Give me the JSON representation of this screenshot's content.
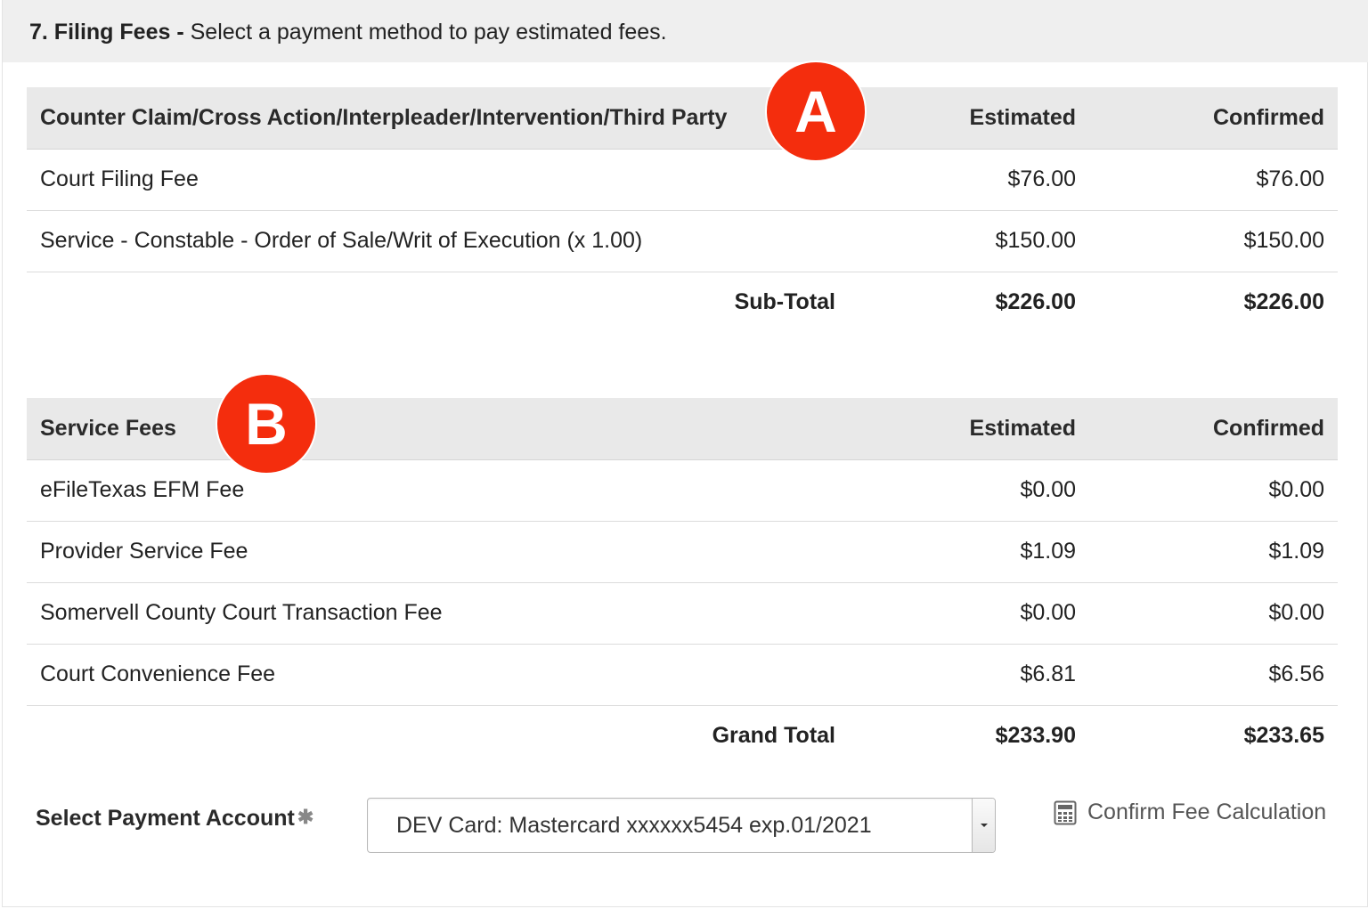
{
  "header": {
    "section_number": "7. Filing Fees -",
    "instruction": "Select a payment method to pay estimated fees."
  },
  "filing_table": {
    "title": "Counter Claim/Cross Action/Interpleader/Intervention/Third Party",
    "col_estimated": "Estimated",
    "col_confirmed": "Confirmed",
    "rows": [
      {
        "label": "Court Filing Fee",
        "estimated": "$76.00",
        "confirmed": "$76.00"
      },
      {
        "label": "Service - Constable - Order of Sale/Writ of Execution (x 1.00)",
        "estimated": "$150.00",
        "confirmed": "$150.00"
      }
    ],
    "total_label": "Sub-Total",
    "total_estimated": "$226.00",
    "total_confirmed": "$226.00"
  },
  "service_table": {
    "title": "Service Fees",
    "col_estimated": "Estimated",
    "col_confirmed": "Confirmed",
    "rows": [
      {
        "label": "eFileTexas EFM Fee",
        "estimated": "$0.00",
        "confirmed": "$0.00"
      },
      {
        "label": "Provider Service Fee",
        "estimated": "$1.09",
        "confirmed": "$1.09"
      },
      {
        "label": "Somervell County Court Transaction Fee",
        "estimated": "$0.00",
        "confirmed": "$0.00"
      },
      {
        "label": "Court Convenience Fee",
        "estimated": "$6.81",
        "confirmed": "$6.56"
      }
    ],
    "total_label": "Grand Total",
    "total_estimated": "$233.90",
    "total_confirmed": "$233.65"
  },
  "markers": {
    "a": "A",
    "b": "B",
    "color": "#f42d0d"
  },
  "payment": {
    "label": "Select Payment Account",
    "required_mark": "✱",
    "selected_account": "DEV Card: Mastercard xxxxxx5454 exp.01/2021",
    "confirm_link": "Confirm Fee Calculation",
    "confirm_icon": "calculator-icon"
  }
}
